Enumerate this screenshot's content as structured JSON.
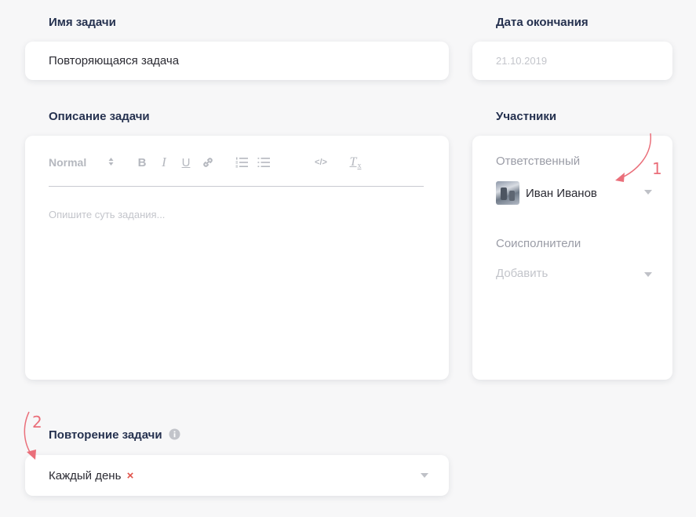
{
  "task_name": {
    "label": "Имя задачи",
    "value": "Повторяющаяся задача"
  },
  "due_date": {
    "label": "Дата окончания",
    "placeholder": "21.10.2019"
  },
  "description": {
    "label": "Описание задачи",
    "placeholder": "Опишите суть задания...",
    "toolbar": {
      "style_select": "Normal",
      "bold": "B",
      "italic": "I",
      "underline": "U",
      "link_icon": "link-icon",
      "ordered_list_icon": "ordered-list-icon",
      "bullet_list_icon": "bullet-list-icon",
      "code": "</>",
      "clear_format": "T"
    }
  },
  "participants": {
    "label": "Участники",
    "responsible_label": "Ответственный",
    "responsible_name": "Иван Иванов",
    "coexecutors_label": "Соисполнители",
    "coexecutors_placeholder": "Добавить"
  },
  "repeat": {
    "label": "Повторение задачи",
    "value": "Каждый день",
    "remove_symbol": "×"
  },
  "annotations": {
    "one": "1",
    "two": "2"
  },
  "colors": {
    "label": "#25314f",
    "annotation": "#ea6f7a",
    "muted": "#9a9ca6",
    "placeholder": "#c3c5cb",
    "remove": "#e0534a"
  }
}
